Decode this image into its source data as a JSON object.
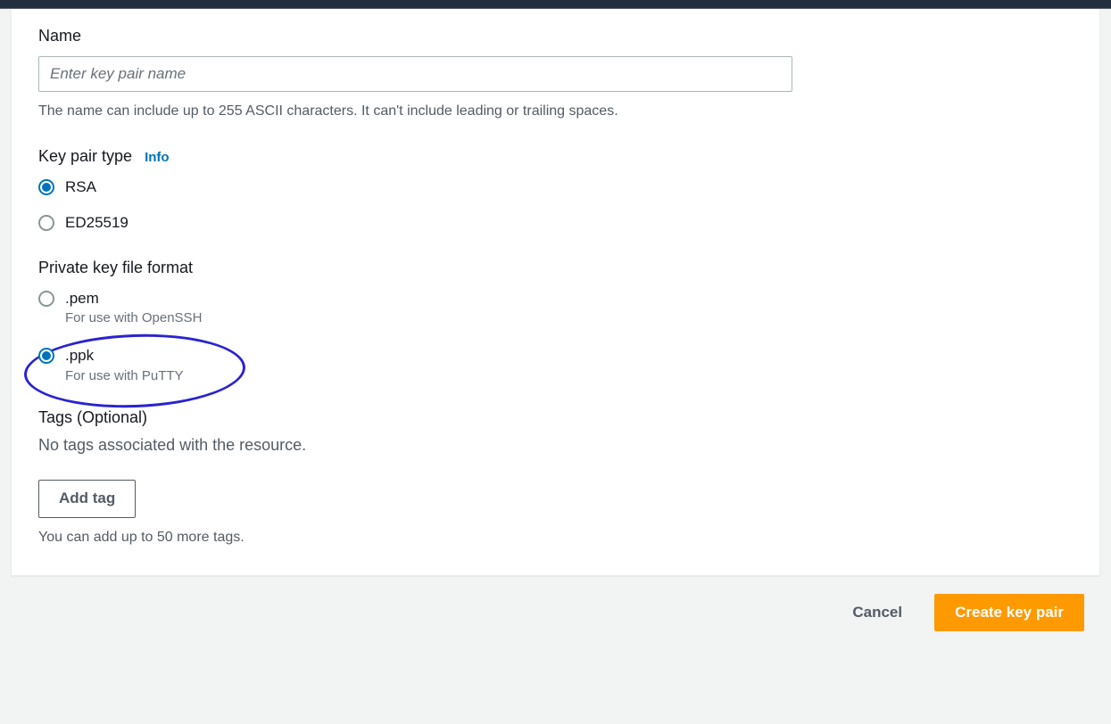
{
  "name_section": {
    "label": "Name",
    "placeholder": "Enter key pair name",
    "help": "The name can include up to 255 ASCII characters. It can't include leading or trailing spaces."
  },
  "type_section": {
    "label": "Key pair type",
    "info_link": "Info",
    "options": [
      {
        "label": "RSA",
        "selected": true
      },
      {
        "label": "ED25519",
        "selected": false
      }
    ]
  },
  "format_section": {
    "label": "Private key file format",
    "options": [
      {
        "label": ".pem",
        "sub": "For use with OpenSSH",
        "selected": false
      },
      {
        "label": ".ppk",
        "sub": "For use with PuTTY",
        "selected": true
      }
    ]
  },
  "tags_section": {
    "heading": "Tags (Optional)",
    "empty_text": "No tags associated with the resource.",
    "add_button": "Add tag",
    "limit_text": "You can add up to 50 more tags."
  },
  "footer": {
    "cancel": "Cancel",
    "create": "Create key pair"
  }
}
